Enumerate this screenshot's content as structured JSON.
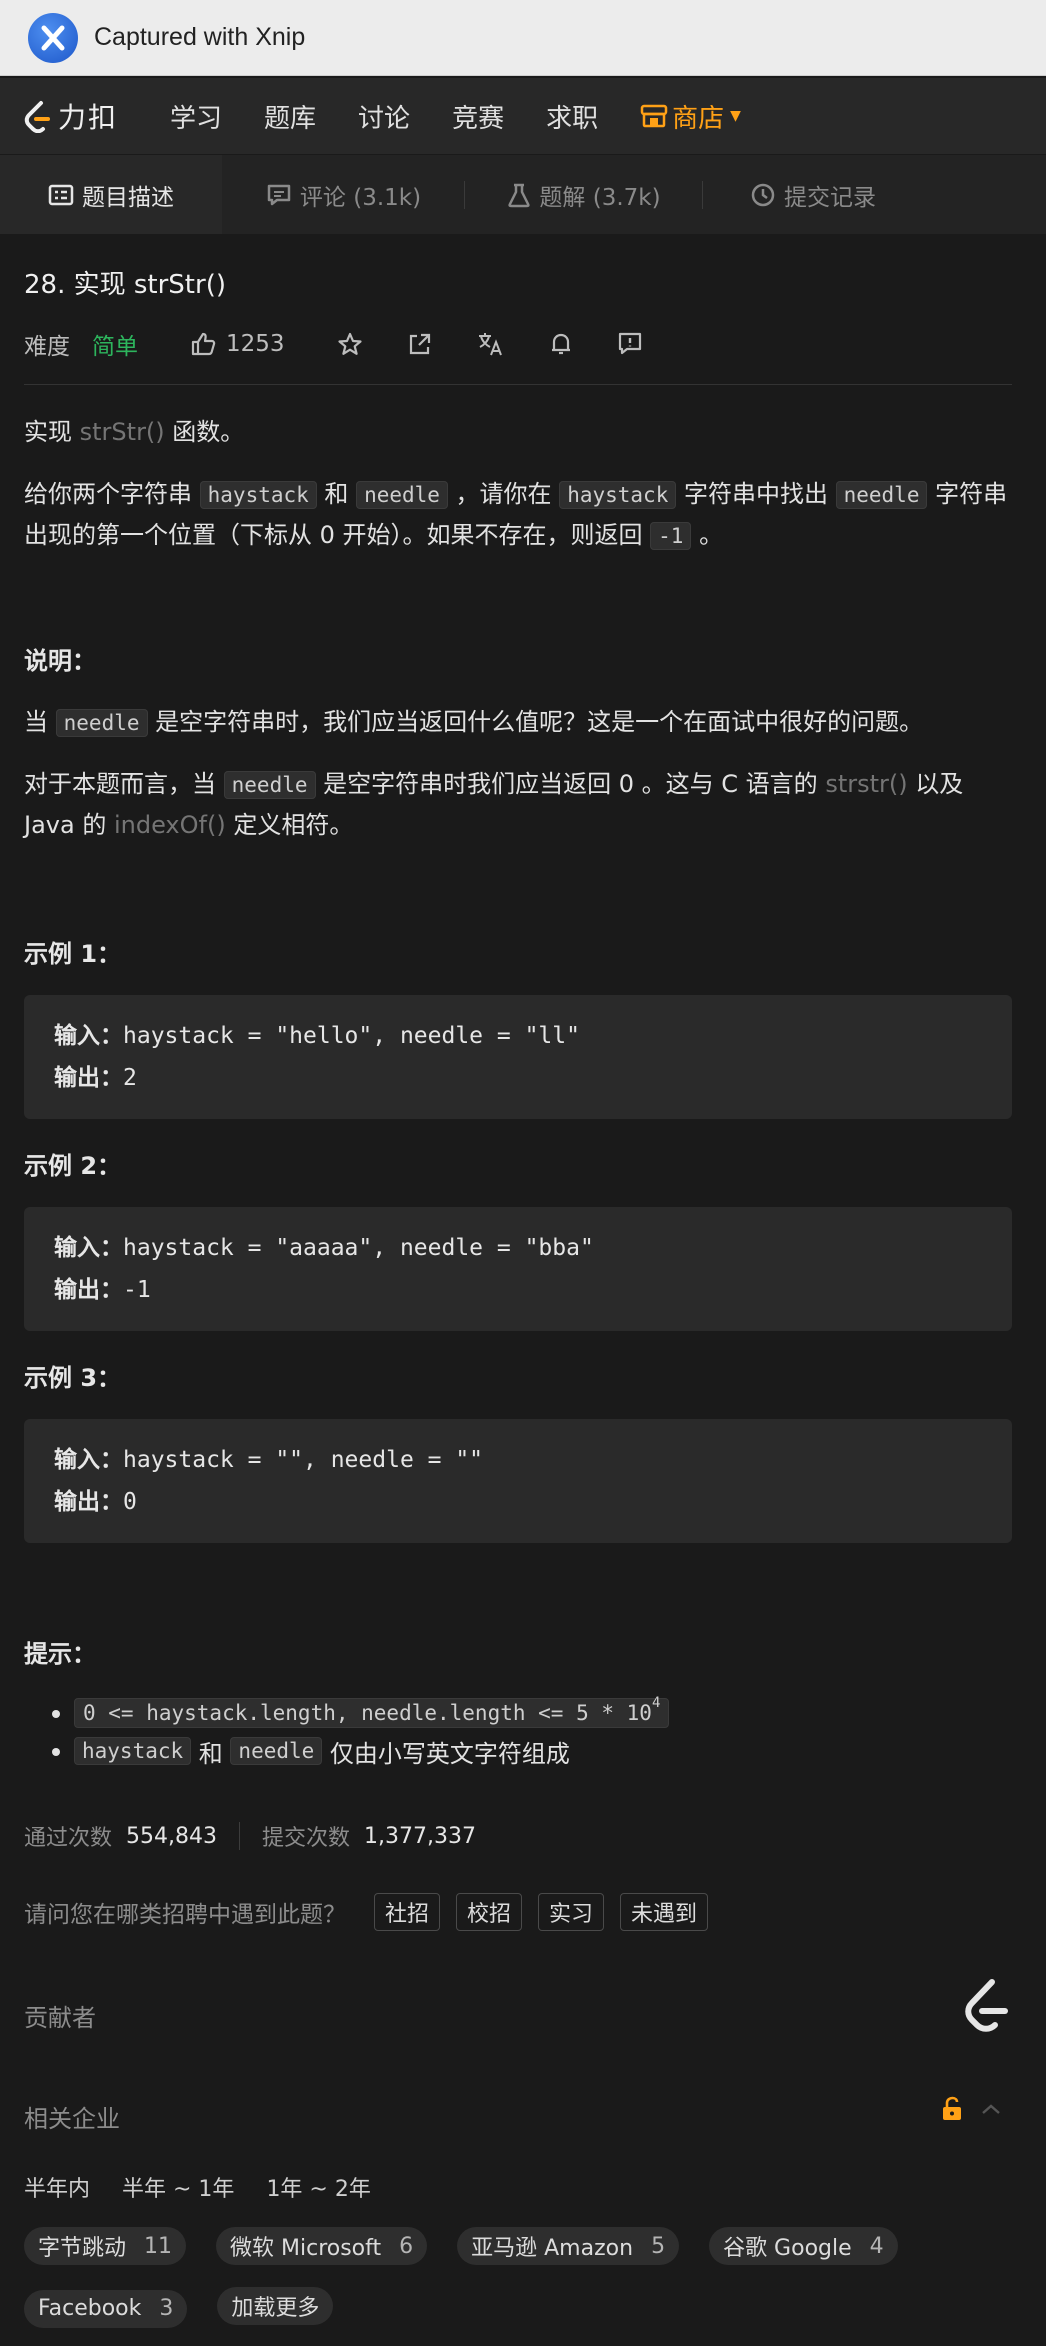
{
  "capture_bar": {
    "title": "Captured with Xnip"
  },
  "nav": {
    "brand": "力扣",
    "items": [
      "学习",
      "题库",
      "讨论",
      "竞赛",
      "求职"
    ],
    "store": "商店"
  },
  "tabs": [
    {
      "label": "题目描述"
    },
    {
      "label": "评论 (3.1k)"
    },
    {
      "label": "题解 (3.7k)"
    },
    {
      "label": "提交记录"
    }
  ],
  "problem": {
    "title": "28. 实现 strStr()",
    "difficulty_label": "难度",
    "difficulty": "简单",
    "likes": "1253"
  },
  "desc": {
    "line1_a": "实现 ",
    "line1_link": "strStr()",
    "line1_b": " 函数。",
    "p2_a": "给你两个字符串 ",
    "p2_code1": "haystack",
    "p2_b": " 和 ",
    "p2_code2": "needle",
    "p2_c": " ，请你在 ",
    "p2_code3": "haystack",
    "p2_d": " 字符串中找出 ",
    "p2_code4": "needle",
    "p2_e": " 字符串出现的第一个位置（下标从 0 开始）。如果不存在，则返回 ",
    "p2_code5": "-1",
    "p2_f": " 。"
  },
  "note": {
    "heading": "说明：",
    "p1_a": "当 ",
    "p1_code": "needle",
    "p1_b": " 是空字符串时，我们应当返回什么值呢？这是一个在面试中很好的问题。",
    "p2_a": "对于本题而言，当 ",
    "p2_code": "needle",
    "p2_b": " 是空字符串时我们应当返回 0 。这与 C 语言的 ",
    "p2_link1": "strstr()",
    "p2_c": " 以及 Java 的 ",
    "p2_link2": "indexOf()",
    "p2_d": " 定义相符。"
  },
  "examples": [
    {
      "heading": "示例 1：",
      "in_label": "输入：",
      "input": "haystack = \"hello\", needle = \"ll\"",
      "out_label": "输出：",
      "output": "2"
    },
    {
      "heading": "示例 2：",
      "in_label": "输入：",
      "input": "haystack = \"aaaaa\", needle = \"bba\"",
      "out_label": "输出：",
      "output": "-1"
    },
    {
      "heading": "示例 3：",
      "in_label": "输入：",
      "input": "haystack = \"\", needle = \"\"",
      "out_label": "输出：",
      "output": "0"
    }
  ],
  "hints": {
    "heading": "提示：",
    "h1_code": "0 <= haystack.length, needle.length <= 5 * 10",
    "h1_sup": "4",
    "h2_code1": "haystack",
    "h2_mid": " 和 ",
    "h2_code2": "needle",
    "h2_tail": " 仅由小写英文字符组成"
  },
  "stats": {
    "accepted_label": "通过次数",
    "accepted": "554,843",
    "submitted_label": "提交次数",
    "submitted": "1,377,337"
  },
  "ask": {
    "question": "请问您在哪类招聘中遇到此题？",
    "options": [
      "社招",
      "校招",
      "实习",
      "未遇到"
    ]
  },
  "contributors": {
    "label": "贡献者"
  },
  "companies": {
    "label": "相关企业",
    "periods": [
      "半年内",
      "半年 ~ 1年",
      "1年 ~ 2年"
    ],
    "items": [
      {
        "name": "字节跳动",
        "count": "11"
      },
      {
        "name": "微软 Microsoft",
        "count": "6"
      },
      {
        "name": "亚马逊 Amazon",
        "count": "5"
      },
      {
        "name": "谷歌 Google",
        "count": "4"
      },
      {
        "name": "Facebook",
        "count": "3"
      }
    ],
    "load_more": "加载更多"
  },
  "colors": {
    "accent": "#ffa116",
    "easy": "#2db55d",
    "background": "#1a1a1a"
  }
}
